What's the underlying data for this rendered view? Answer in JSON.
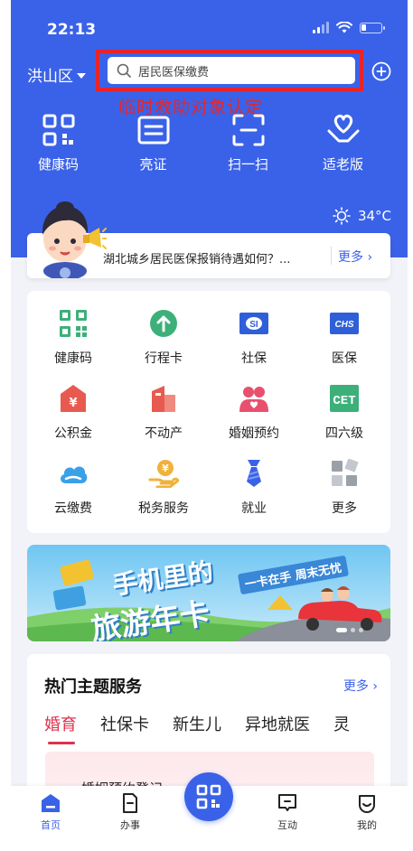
{
  "status": {
    "time": "22:13"
  },
  "header": {
    "district": "洪山区",
    "search_placeholder": "居民医保缴费",
    "annotation": "临时救助对象认定"
  },
  "quick_actions": [
    {
      "label": "健康码",
      "icon": "qr-code-icon"
    },
    {
      "label": "亮证",
      "icon": "id-card-icon"
    },
    {
      "label": "扫一扫",
      "icon": "scan-icon"
    },
    {
      "label": "适老版",
      "icon": "heart-hand-icon"
    }
  ],
  "weather": {
    "temp": "34°C",
    "icon": "sun-icon"
  },
  "notice": {
    "text": "湖北城乡居民医保报销待遇如何？...",
    "more": "更多"
  },
  "services": [
    {
      "label": "健康码",
      "icon": "qr-code-icon",
      "color": "#3db07a"
    },
    {
      "label": "行程卡",
      "icon": "arrow-up-icon",
      "color": "#3db07a"
    },
    {
      "label": "社保",
      "icon": "social-security-icon",
      "color": "#2f5fd8"
    },
    {
      "label": "医保",
      "icon": "medical-insurance-icon",
      "color": "#2f5fd8"
    },
    {
      "label": "公积金",
      "icon": "house-fund-icon",
      "color": "#e85a4f"
    },
    {
      "label": "不动产",
      "icon": "building-icon",
      "color": "#e85a4f"
    },
    {
      "label": "婚姻预约",
      "icon": "couple-icon",
      "color": "#e8506e"
    },
    {
      "label": "四六级",
      "icon": "cet-icon",
      "color": "#3db07a"
    },
    {
      "label": "云缴费",
      "icon": "cloud-icon",
      "color": "#3aa0e8"
    },
    {
      "label": "税务服务",
      "icon": "tax-icon",
      "color": "#f0b23a"
    },
    {
      "label": "就业",
      "icon": "tie-icon",
      "color": "#3a62e8"
    },
    {
      "label": "更多",
      "icon": "more-grid-icon",
      "color": "#9aa0a8"
    }
  ],
  "banner": {
    "title_line1": "手机里的",
    "title_line2": "旅游年卡",
    "slogan": "一卡在手  周末无忧"
  },
  "topics": {
    "title": "热门主题服务",
    "more": "更多",
    "tabs": [
      "婚育",
      "社保卡",
      "新生儿",
      "异地就医",
      "灵"
    ],
    "card_text": "婚姻预约登记"
  },
  "tabbar": [
    {
      "label": "首页",
      "icon": "home-icon"
    },
    {
      "label": "办事",
      "icon": "document-icon"
    },
    {
      "label": "互动",
      "icon": "chat-icon"
    },
    {
      "label": "我的",
      "icon": "smile-icon"
    }
  ],
  "colors": {
    "primary": "#3a62e8",
    "annotation_red": "#e8242a",
    "tab_active": "#e0314e"
  }
}
